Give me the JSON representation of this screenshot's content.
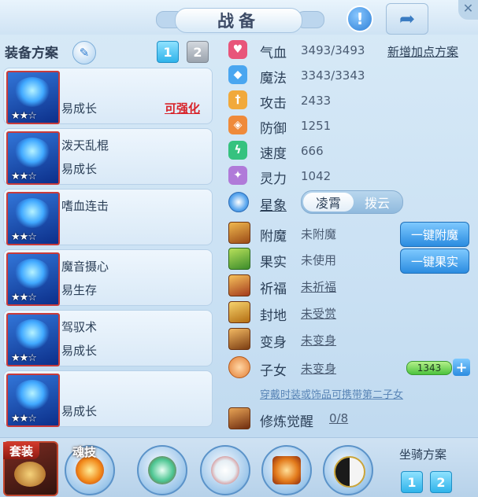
{
  "title": "战备",
  "header": {
    "alert_icon": "exclamation-icon",
    "share_icon": "share-icon"
  },
  "equip_plan": {
    "label": "装备方案",
    "tabs": [
      "1",
      "2"
    ],
    "active_tab": 1
  },
  "cards": [
    {
      "name": "",
      "sub": "易成长",
      "action": "可强化",
      "stars": "★★☆"
    },
    {
      "name": "泼天乱棍",
      "sub": "易成长",
      "action": "",
      "stars": "★★☆"
    },
    {
      "name": "嗜血连击",
      "sub": "",
      "action": "",
      "stars": "★★☆"
    },
    {
      "name": "魔音摄心",
      "sub": "易生存",
      "action": "",
      "stars": "★★☆"
    },
    {
      "name": "驾驭术",
      "sub": "易成长",
      "action": "",
      "stars": "★★☆"
    },
    {
      "name": "",
      "sub": "易成长",
      "action": "",
      "stars": "★★☆"
    }
  ],
  "stats": [
    {
      "label": "气血",
      "value": "3493/3493",
      "icon": "heart-icon",
      "color": "#e8557a"
    },
    {
      "label": "魔法",
      "value": "3343/3343",
      "icon": "mana-icon",
      "color": "#4aa6f0"
    },
    {
      "label": "攻击",
      "value": "2433",
      "icon": "sword-icon",
      "color": "#f1a93b"
    },
    {
      "label": "防御",
      "value": "1251",
      "icon": "shield-icon",
      "color": "#ef8a3a"
    },
    {
      "label": "速度",
      "value": "666",
      "icon": "lightning-icon",
      "color": "#35c27f"
    },
    {
      "label": "灵力",
      "value": "1042",
      "icon": "spirit-icon",
      "color": "#b07ad9"
    }
  ],
  "add_plan": "新增加点方案",
  "star_sign": {
    "label": "星象",
    "options": [
      "凌霄",
      "拨云"
    ],
    "selected": "凌霄"
  },
  "info_rows": [
    {
      "label": "附魔",
      "value": "未附魔",
      "underline": false
    },
    {
      "label": "果实",
      "value": "未使用",
      "underline": false
    },
    {
      "label": "祈福",
      "value": "未祈福",
      "underline": true
    },
    {
      "label": "封地",
      "value": "未受赏",
      "underline": true
    },
    {
      "label": "变身",
      "value": "未变身",
      "underline": true
    },
    {
      "label": "子女",
      "value": "未变身",
      "underline": true
    },
    {
      "label": "修炼觉醒",
      "value": "0/8",
      "underline": true
    }
  ],
  "buttons": {
    "enchant": "一键附魔",
    "fruit": "一键果实"
  },
  "child_value": "1343",
  "note": "穿戴时装或饰品可携带第二子女",
  "bottom": {
    "suit": "套装",
    "soul_skill": "魂技",
    "mount_plan": "坐骑方案",
    "mount_tabs": [
      "1",
      "2"
    ]
  }
}
